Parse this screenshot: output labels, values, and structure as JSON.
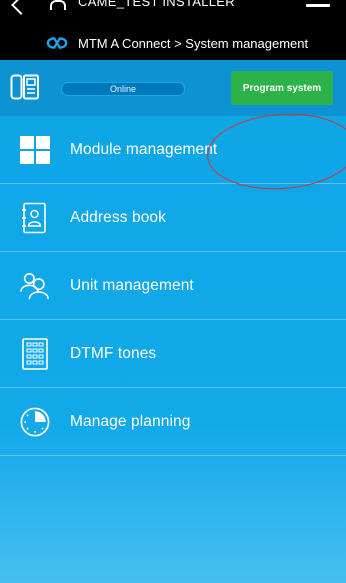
{
  "header": {
    "installer_name": "CAME_TEST INSTALLER",
    "breadcrumb": "MTM A Connect > System management"
  },
  "status": {
    "connection": "Online",
    "program_button": "Program system"
  },
  "menu": {
    "items": [
      {
        "label": "Module management",
        "icon": "grid-icon"
      },
      {
        "label": "Address book",
        "icon": "address-book-icon"
      },
      {
        "label": "Unit management",
        "icon": "users-icon"
      },
      {
        "label": "DTMF tones",
        "icon": "keypad-icon"
      },
      {
        "label": "Manage planning",
        "icon": "clock-icon"
      }
    ]
  },
  "colors": {
    "header_bg": "#000000",
    "main_bg": "#0ea5e6",
    "status_bar_bg": "#0e93d2",
    "program_button": "#2bb34a",
    "annotation_ellipse": "#d43131"
  }
}
